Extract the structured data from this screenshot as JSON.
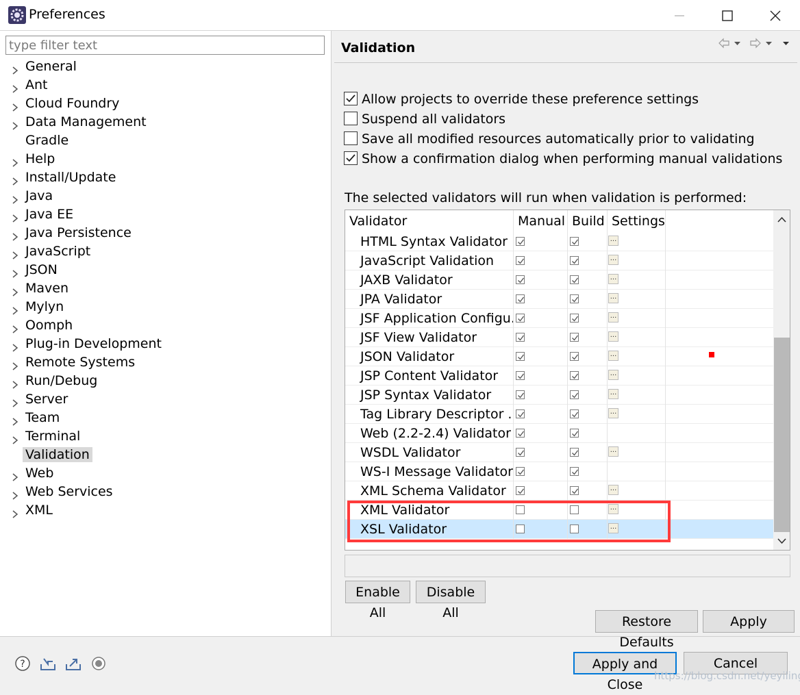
{
  "window": {
    "title": "Preferences",
    "app_icon": "eclipse-gear-icon"
  },
  "sidebar": {
    "filter_placeholder": "type filter text",
    "items": [
      {
        "label": "General",
        "expandable": true
      },
      {
        "label": "Ant",
        "expandable": true
      },
      {
        "label": "Cloud Foundry",
        "expandable": true
      },
      {
        "label": "Data Management",
        "expandable": true
      },
      {
        "label": "Gradle",
        "expandable": false
      },
      {
        "label": "Help",
        "expandable": true
      },
      {
        "label": "Install/Update",
        "expandable": true
      },
      {
        "label": "Java",
        "expandable": true
      },
      {
        "label": "Java EE",
        "expandable": true
      },
      {
        "label": "Java Persistence",
        "expandable": true
      },
      {
        "label": "JavaScript",
        "expandable": true
      },
      {
        "label": "JSON",
        "expandable": true
      },
      {
        "label": "Maven",
        "expandable": true
      },
      {
        "label": "Mylyn",
        "expandable": true
      },
      {
        "label": "Oomph",
        "expandable": true
      },
      {
        "label": "Plug-in Development",
        "expandable": true
      },
      {
        "label": "Remote Systems",
        "expandable": true
      },
      {
        "label": "Run/Debug",
        "expandable": true
      },
      {
        "label": "Server",
        "expandable": true
      },
      {
        "label": "Team",
        "expandable": true
      },
      {
        "label": "Terminal",
        "expandable": true
      },
      {
        "label": "Validation",
        "expandable": false,
        "selected": true
      },
      {
        "label": "Web",
        "expandable": true
      },
      {
        "label": "Web Services",
        "expandable": true
      },
      {
        "label": "XML",
        "expandable": true
      }
    ]
  },
  "main": {
    "title": "Validation",
    "options": [
      {
        "label": "Allow projects to override these preference settings",
        "checked": true
      },
      {
        "label": "Suspend all validators",
        "checked": false
      },
      {
        "label": "Save all modified resources automatically prior to validating",
        "checked": false
      },
      {
        "label": "Show a confirmation dialog when performing manual validations",
        "checked": true
      }
    ],
    "table_caption": "The selected validators will run when validation is performed:",
    "columns": {
      "validator": "Validator",
      "manual": "Manual",
      "build": "Build",
      "settings": "Settings"
    },
    "rows": [
      {
        "name": "HTML Syntax Validator",
        "manual": true,
        "build": true,
        "settings": true
      },
      {
        "name": "JavaScript Validation",
        "manual": true,
        "build": true,
        "settings": true
      },
      {
        "name": "JAXB Validator",
        "manual": true,
        "build": true,
        "settings": true
      },
      {
        "name": "JPA Validator",
        "manual": true,
        "build": true,
        "settings": true
      },
      {
        "name": "JSF Application Configu...",
        "manual": true,
        "build": true,
        "settings": true
      },
      {
        "name": "JSF View Validator",
        "manual": true,
        "build": true,
        "settings": true
      },
      {
        "name": "JSON Validator",
        "manual": true,
        "build": true,
        "settings": true
      },
      {
        "name": "JSP Content Validator",
        "manual": true,
        "build": true,
        "settings": true
      },
      {
        "name": "JSP Syntax Validator",
        "manual": true,
        "build": true,
        "settings": true
      },
      {
        "name": "Tag Library Descriptor ...",
        "manual": true,
        "build": true,
        "settings": true
      },
      {
        "name": "Web (2.2-2.4) Validator",
        "manual": true,
        "build": true,
        "settings": false
      },
      {
        "name": "WSDL Validator",
        "manual": true,
        "build": true,
        "settings": true
      },
      {
        "name": "WS-I Message Validator",
        "manual": true,
        "build": true,
        "settings": false
      },
      {
        "name": "XML Schema Validator",
        "manual": true,
        "build": true,
        "settings": true
      },
      {
        "name": "XML Validator",
        "manual": false,
        "build": false,
        "settings": true
      },
      {
        "name": "XSL Validator",
        "manual": false,
        "build": false,
        "settings": true,
        "selected": true
      }
    ],
    "settings_button_label": "...",
    "enable_all": "Enable All",
    "disable_all": "Disable All",
    "restore_defaults": "Restore Defaults",
    "apply": "Apply"
  },
  "footer": {
    "apply_and_close": "Apply and Close",
    "cancel": "Cancel",
    "icons": [
      "help-icon",
      "import-icon",
      "export-icon",
      "record-icon"
    ]
  },
  "watermark": "https://blog.csdn.net/yeyiling",
  "colors": {
    "highlight_border": "#ff3b3b",
    "selected_row": "#cce8ff",
    "default_button_border": "#0078d7"
  }
}
